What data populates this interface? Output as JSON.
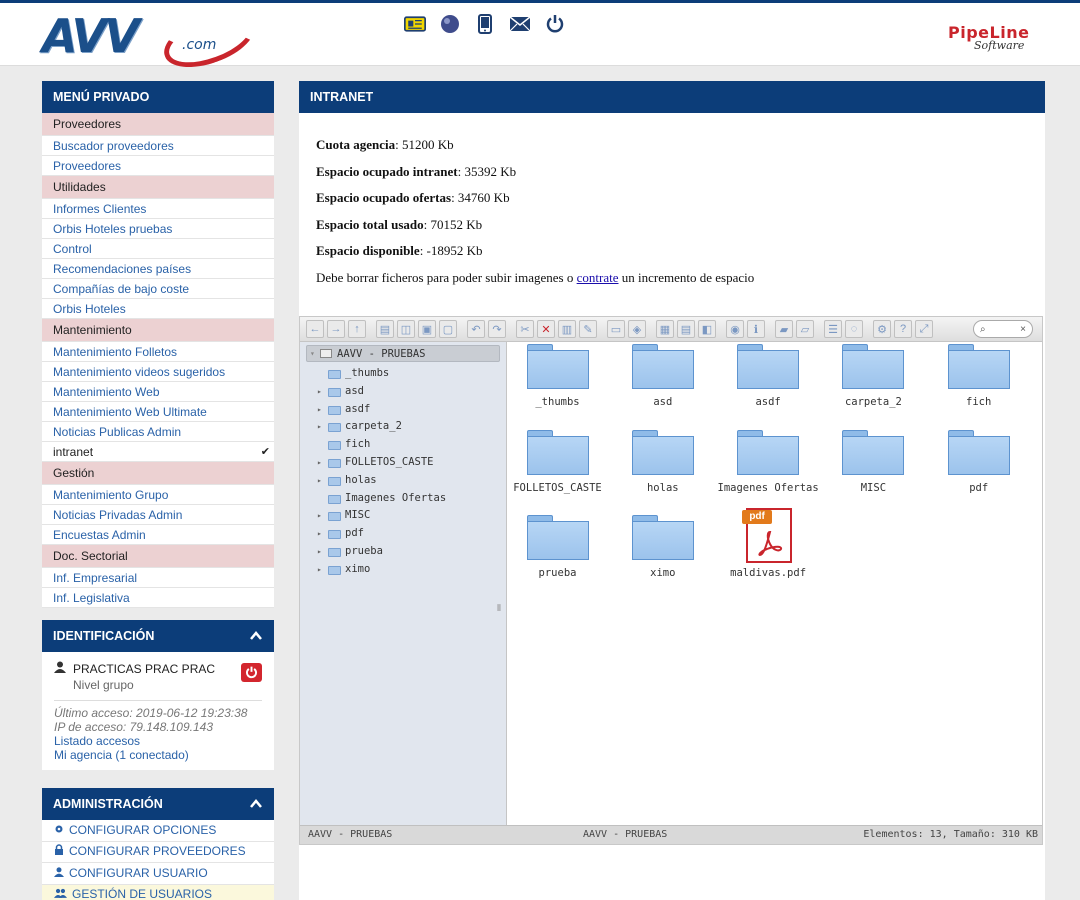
{
  "header": {
    "logo_text": "AVV",
    "logo_suffix": ".com",
    "icons": [
      "newspaper-icon",
      "globe-icon",
      "mobile-icon",
      "mail-icon",
      "power-icon"
    ],
    "partner_logo_title": "PipeLine",
    "partner_logo_sub": "Software"
  },
  "menu": {
    "title": "MENÚ PRIVADO",
    "items": [
      {
        "label": "Proveedores",
        "type": "section"
      },
      {
        "label": "Buscador proveedores",
        "type": "link"
      },
      {
        "label": "Proveedores",
        "type": "link"
      },
      {
        "label": "Utilidades",
        "type": "section"
      },
      {
        "label": "Informes Clientes",
        "type": "link"
      },
      {
        "label": "Orbis Hoteles pruebas",
        "type": "link"
      },
      {
        "label": "Control",
        "type": "link"
      },
      {
        "label": "Recomendaciones países",
        "type": "link"
      },
      {
        "label": "Compañías de bajo coste",
        "type": "link"
      },
      {
        "label": "Orbis Hoteles",
        "type": "link"
      },
      {
        "label": "Mantenimiento",
        "type": "section"
      },
      {
        "label": "Mantenimiento Folletos",
        "type": "link"
      },
      {
        "label": "Mantenimiento videos sugeridos",
        "type": "link"
      },
      {
        "label": "Mantenimiento Web",
        "type": "link"
      },
      {
        "label": "Mantenimiento Web Ultimate",
        "type": "link"
      },
      {
        "label": "Noticias Publicas Admin",
        "type": "link"
      },
      {
        "label": "intranet",
        "type": "active",
        "check": "✔"
      },
      {
        "label": "Gestión",
        "type": "section"
      },
      {
        "label": "Mantenimiento Grupo",
        "type": "link"
      },
      {
        "label": "Noticias Privadas Admin",
        "type": "link"
      },
      {
        "label": "Encuestas Admin",
        "type": "link"
      },
      {
        "label": "Doc. Sectorial",
        "type": "section"
      },
      {
        "label": "Inf. Empresarial",
        "type": "link"
      },
      {
        "label": "Inf. Legislativa",
        "type": "link"
      }
    ]
  },
  "identification": {
    "title": "IDENTIFICACIÓN",
    "user_name": "PRACTICAS PRAC PRAC",
    "user_level": "Nivel grupo",
    "last_access": "Último acceso: 2019-06-12 19:23:38",
    "ip": "IP de acceso: 79.148.109.143",
    "access_list": "Listado accesos",
    "agency": "Mi agencia (1 conectado)"
  },
  "admin": {
    "title": "ADMINISTRACIÓN",
    "items": [
      {
        "label": "CONFIGURAR OPCIONES",
        "icon": "gear-icon"
      },
      {
        "label": "CONFIGURAR PROVEEDORES",
        "icon": "lock-icon"
      },
      {
        "label": "CONFIGURAR USUARIO",
        "icon": "user-icon"
      },
      {
        "label": "GESTIÓN DE USUARIOS",
        "icon": "users-icon"
      }
    ]
  },
  "main": {
    "title": "INTRANET",
    "quota": [
      {
        "label": "Cuota agencia",
        "value": ": 51200 Kb"
      },
      {
        "label": "Espacio ocupado intranet",
        "value": ": 35392 Kb"
      },
      {
        "label": "Espacio ocupado ofertas",
        "value": ": 34760 Kb"
      },
      {
        "label": "Espacio total usado",
        "value": ": 70152 Kb"
      },
      {
        "label": "Espacio disponible",
        "value": ": -18952 Kb"
      }
    ],
    "notice_before": "Debe borrar ficheros para poder subir imagenes o ",
    "notice_link": "contrate",
    "notice_after": " un incremento de espacio"
  },
  "file_manager": {
    "search_icon": "⌕",
    "search_clear": "×",
    "tree_root": "AAVV - PRUEBAS",
    "tree": [
      {
        "label": "_thumbs",
        "expandable": false
      },
      {
        "label": "asd",
        "expandable": true
      },
      {
        "label": "asdf",
        "expandable": true
      },
      {
        "label": "carpeta_2",
        "expandable": true
      },
      {
        "label": "fich",
        "expandable": false
      },
      {
        "label": "FOLLETOS_CASTE",
        "expandable": true
      },
      {
        "label": "holas",
        "expandable": true
      },
      {
        "label": "Imagenes Ofertas",
        "expandable": false
      },
      {
        "label": "MISC",
        "expandable": true
      },
      {
        "label": "pdf",
        "expandable": true
      },
      {
        "label": "prueba",
        "expandable": true
      },
      {
        "label": "ximo",
        "expandable": true
      }
    ],
    "files": [
      {
        "name": "_thumbs",
        "kind": "folder"
      },
      {
        "name": "asd",
        "kind": "folder"
      },
      {
        "name": "asdf",
        "kind": "folder"
      },
      {
        "name": "carpeta_2",
        "kind": "folder"
      },
      {
        "name": "fich",
        "kind": "folder"
      },
      {
        "name": "FOLLETOS_CASTE",
        "kind": "folder"
      },
      {
        "name": "holas",
        "kind": "folder"
      },
      {
        "name": "Imagenes Ofertas",
        "kind": "folder"
      },
      {
        "name": "MISC",
        "kind": "folder"
      },
      {
        "name": "pdf",
        "kind": "folder"
      },
      {
        "name": "prueba",
        "kind": "folder"
      },
      {
        "name": "ximo",
        "kind": "folder"
      },
      {
        "name": "maldivas.pdf",
        "kind": "pdf",
        "tag": "pdf"
      }
    ],
    "status_left": "AAVV - PRUEBAS",
    "status_center": "AAVV - PRUEBAS",
    "status_right": "Elementos: 13, Tamaño: 310 KB"
  },
  "colors": {
    "brand_blue": "#0c3d79",
    "section_pink": "#ecd1d2",
    "link_blue": "#2a62a8",
    "logout_red": "#d3262e"
  }
}
